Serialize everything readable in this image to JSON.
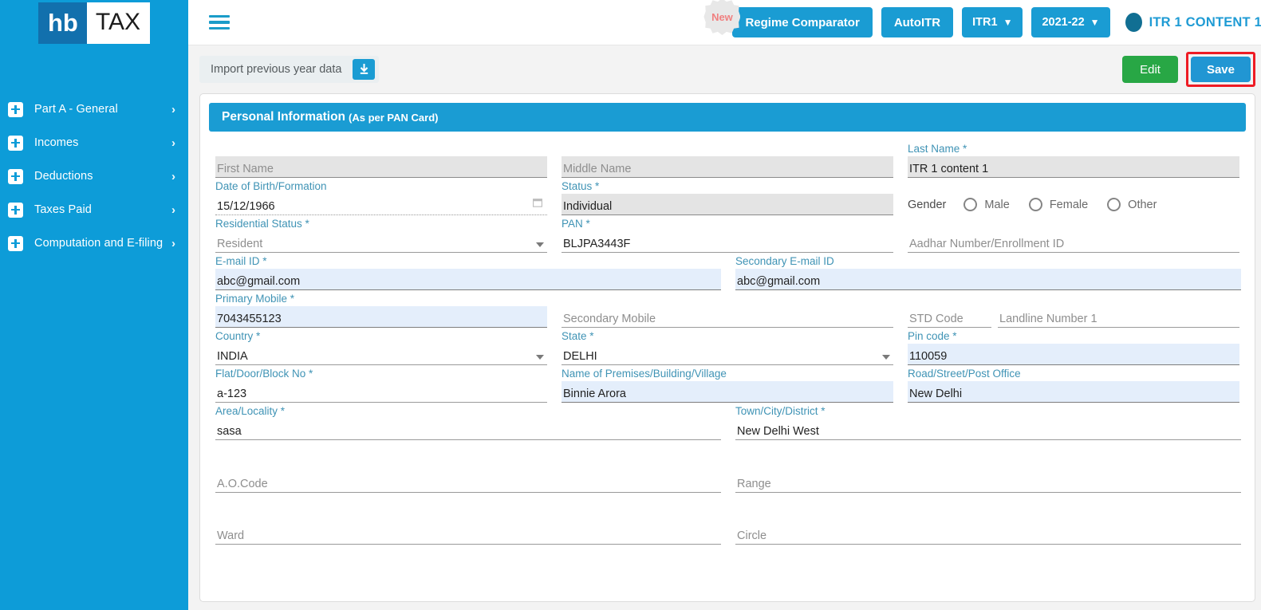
{
  "brand": {
    "logo_left": "hb",
    "logo_right": "TAX",
    "accent": "#0d9cd8",
    "header_blue": "#1a9cd3"
  },
  "sidebar": {
    "items": [
      {
        "label": "Part A - General"
      },
      {
        "label": "Incomes"
      },
      {
        "label": "Deductions"
      },
      {
        "label": "Taxes Paid"
      },
      {
        "label": "Computation and E-filing"
      }
    ]
  },
  "topbar": {
    "menu_icon": "hamburger-icon",
    "new_badge": "New",
    "regime_comparator": "Regime Comparator",
    "auto_itr": "AutoITR",
    "itr_select": "ITR1",
    "year_select": "2021-22",
    "user_name": "ITR 1 CONTENT 1"
  },
  "actionbar": {
    "import_label": "Import previous year data",
    "import_icon": "download-icon",
    "edit_label": "Edit",
    "save_label": "Save",
    "save_highlight_color": "#ee1b24"
  },
  "card": {
    "title": "Personal Information",
    "subtitle": "(As per PAN Card)"
  },
  "form": {
    "first_name": {
      "label": "",
      "placeholder": "First Name",
      "value": ""
    },
    "middle_name": {
      "label": "",
      "placeholder": "Middle Name",
      "value": ""
    },
    "last_name": {
      "label": "Last Name *",
      "placeholder": "",
      "value": "ITR 1 content 1"
    },
    "dob": {
      "label": "Date of Birth/Formation",
      "placeholder": "",
      "value": "15/12/1966"
    },
    "status": {
      "label": "Status *",
      "placeholder": "",
      "value": "Individual"
    },
    "gender": {
      "label": "Gender",
      "options": [
        "Male",
        "Female",
        "Other"
      ],
      "selected": ""
    },
    "residential_status": {
      "label": "Residential Status *",
      "placeholder": "",
      "value": "Resident"
    },
    "pan": {
      "label": "PAN *",
      "placeholder": "",
      "value": "BLJPA3443F"
    },
    "aadhar": {
      "label": "",
      "placeholder": "Aadhar Number/Enrollment ID",
      "value": ""
    },
    "email": {
      "label": "E-mail ID *",
      "placeholder": "",
      "value": "abc@gmail.com"
    },
    "secondary_email": {
      "label": "Secondary E-mail ID",
      "placeholder": "",
      "value": "abc@gmail.com"
    },
    "primary_mobile": {
      "label": "Primary Mobile *",
      "placeholder": "",
      "value": "7043455123"
    },
    "secondary_mobile": {
      "label": "",
      "placeholder": "Secondary Mobile",
      "value": ""
    },
    "std_code": {
      "label": "",
      "placeholder": "STD Code",
      "value": ""
    },
    "landline": {
      "label": "",
      "placeholder": "Landline Number 1",
      "value": ""
    },
    "country": {
      "label": "Country *",
      "placeholder": "",
      "value": "INDIA"
    },
    "state": {
      "label": "State *",
      "placeholder": "",
      "value": "DELHI"
    },
    "pin_code": {
      "label": "Pin code *",
      "placeholder": "",
      "value": "110059"
    },
    "flat_door": {
      "label": "Flat/Door/Block No *",
      "placeholder": "",
      "value": "a-123"
    },
    "premises": {
      "label": "Name of Premises/Building/Village",
      "placeholder": "",
      "value": "Binnie Arora"
    },
    "road_street": {
      "label": "Road/Street/Post Office",
      "placeholder": "",
      "value": "New Delhi"
    },
    "area_locality": {
      "label": "Area/Locality *",
      "placeholder": "",
      "value": "sasa"
    },
    "town_city": {
      "label": "Town/City/District *",
      "placeholder": "",
      "value": "New Delhi West"
    },
    "ao_code": {
      "label": "",
      "placeholder": "A.O.Code",
      "value": ""
    },
    "range": {
      "label": "",
      "placeholder": "Range",
      "value": ""
    },
    "ward": {
      "label": "",
      "placeholder": "Ward",
      "value": ""
    },
    "circle": {
      "label": "",
      "placeholder": "Circle",
      "value": ""
    }
  }
}
